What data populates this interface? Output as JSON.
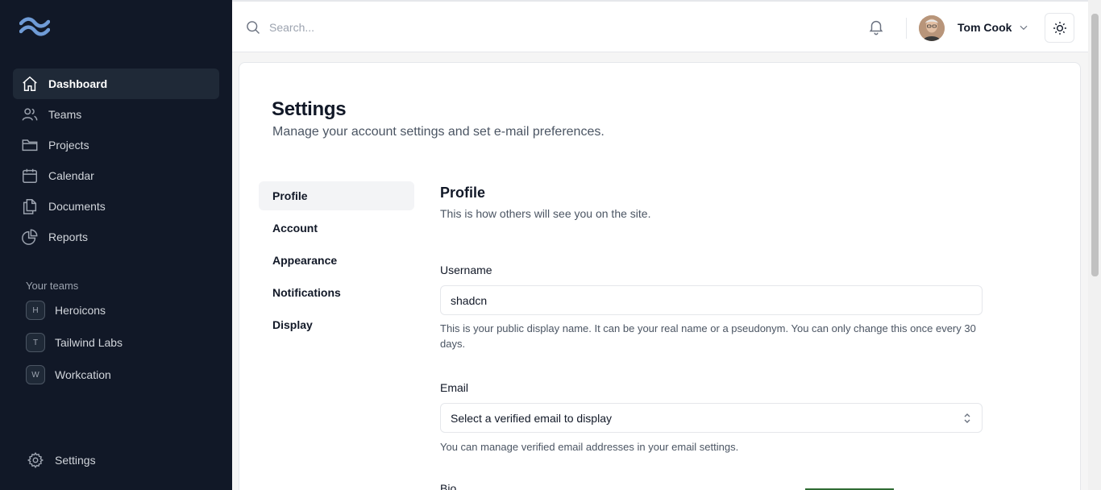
{
  "sidebar": {
    "nav": [
      {
        "label": "Dashboard",
        "icon": "home-icon"
      },
      {
        "label": "Teams",
        "icon": "users-icon"
      },
      {
        "label": "Projects",
        "icon": "folder-icon"
      },
      {
        "label": "Calendar",
        "icon": "calendar-icon"
      },
      {
        "label": "Documents",
        "icon": "documents-icon"
      },
      {
        "label": "Reports",
        "icon": "chart-pie-icon"
      }
    ],
    "teams_title": "Your teams",
    "teams": [
      {
        "initial": "H",
        "label": "Heroicons"
      },
      {
        "initial": "T",
        "label": "Tailwind Labs"
      },
      {
        "initial": "W",
        "label": "Workcation"
      }
    ],
    "settings_label": "Settings"
  },
  "topbar": {
    "search_placeholder": "Search...",
    "user_name": "Tom Cook"
  },
  "main": {
    "title": "Settings",
    "subtitle": "Manage your account settings and set e-mail preferences.",
    "tabs": [
      "Profile",
      "Account",
      "Appearance",
      "Notifications",
      "Display"
    ],
    "profile": {
      "heading": "Profile",
      "description": "This is how others will see you on the site.",
      "username_label": "Username",
      "username_value": "shadcn",
      "username_help": "This is your public display name. It can be your real name or a pseudonym. You can only change this once every 30 days.",
      "email_label": "Email",
      "email_select": "Select a verified email to display",
      "email_help": "You can manage verified email addresses in your email settings.",
      "bio_label": "Bio"
    }
  },
  "colors": {
    "sidebar_bg": "#111827",
    "sidebar_active": "#1f2937",
    "accent_green": "#2f6b33"
  }
}
